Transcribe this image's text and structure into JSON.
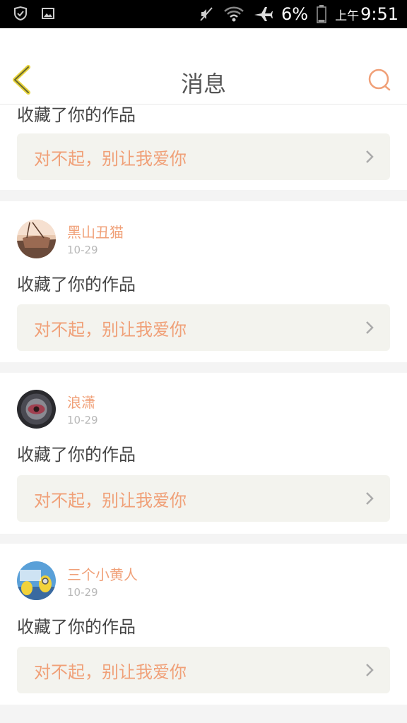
{
  "status_bar": {
    "battery": "6%",
    "time_prefix": "上午",
    "time": "9:51",
    "icons": [
      "shield-check-icon",
      "image-icon",
      "mute-icon",
      "wifi-icon",
      "airplane-icon",
      "battery-icon"
    ]
  },
  "nav": {
    "title": "消息",
    "back_icon": "back-chevron-icon",
    "search_icon": "search-icon",
    "accent": "#f0a078"
  },
  "messages": [
    {
      "action": "收藏了你的作品",
      "work_title": "对不起，别让我爱你"
    },
    {
      "username": "黑山丑猫",
      "date": "10-29",
      "action": "收藏了你的作品",
      "work_title": "对不起，别让我爱你"
    },
    {
      "username": "浪潇",
      "date": "10-29",
      "action": "收藏了你的作品",
      "work_title": "对不起，别让我爱你"
    },
    {
      "username": "三个小黄人",
      "date": "10-29",
      "action": "收藏了你的作品",
      "work_title": "对不起，别让我爱你"
    }
  ],
  "colors": {
    "accent": "#f0a078",
    "quote_bg": "#f3f3ee",
    "divider": "#f4f4f4"
  }
}
